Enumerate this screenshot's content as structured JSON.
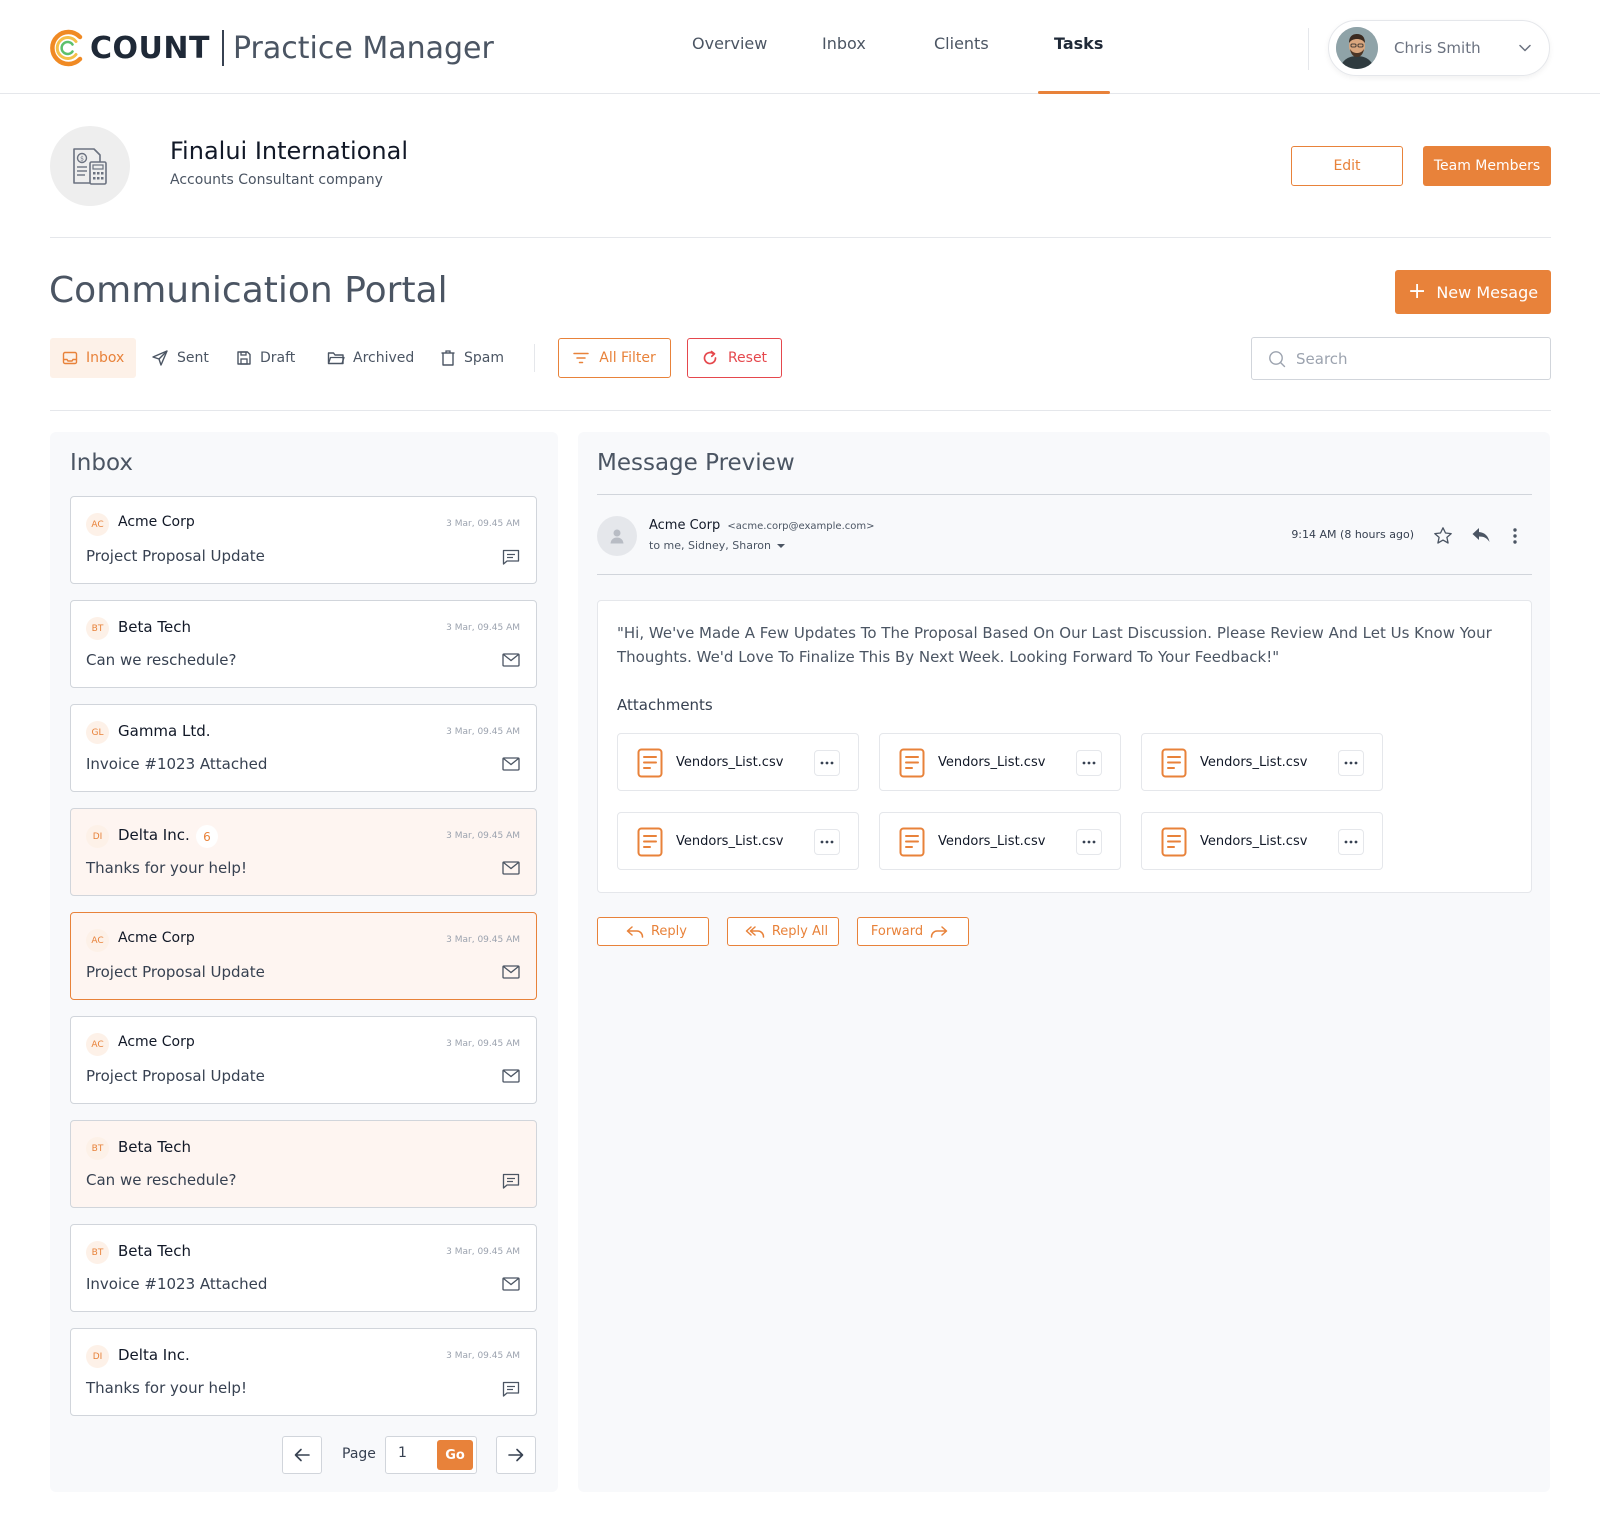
{
  "app": {
    "brand": "COUNT",
    "product": "Practice Manager"
  },
  "nav": {
    "items": [
      {
        "label": "Overview",
        "active": false
      },
      {
        "label": "Inbox",
        "active": false
      },
      {
        "label": "Clients",
        "active": false
      },
      {
        "label": "Tasks",
        "active": true
      }
    ]
  },
  "user": {
    "name": "Chris Smith"
  },
  "client": {
    "name": "Finalui International",
    "subtitle": "Accounts Consultant company",
    "edit_label": "Edit",
    "team_label": "Team Members"
  },
  "portal": {
    "title": "Communication Portal",
    "new_message_label": "New Mesage",
    "tabs": [
      {
        "label": "Inbox",
        "icon": "inbox-icon",
        "active": true
      },
      {
        "label": "Sent",
        "icon": "send-icon",
        "active": false
      },
      {
        "label": "Draft",
        "icon": "save-icon",
        "active": false
      },
      {
        "label": "Archived",
        "icon": "folder-icon",
        "active": false
      },
      {
        "label": "Spam",
        "icon": "trash-icon",
        "active": false
      }
    ],
    "filter_label": "All Filter",
    "reset_label": "Reset",
    "search_placeholder": "Search"
  },
  "inbox": {
    "title": "Inbox",
    "messages": [
      {
        "initials": "AC",
        "sender": "Acme Corp",
        "time": "3 Mar, 09.45 AM",
        "subject": "Project Proposal Update",
        "icon": "message-icon",
        "state": "read"
      },
      {
        "initials": "BT",
        "sender": "Beta Tech",
        "time": "3 Mar, 09.45 AM",
        "subject": "Can we reschedule?",
        "icon": "mail-icon",
        "state": "read"
      },
      {
        "initials": "GL",
        "sender": "Gamma Ltd.",
        "time": "3 Mar, 09.45 AM",
        "subject": "Invoice #1023 Attached",
        "icon": "mail-icon",
        "state": "read"
      },
      {
        "initials": "DI",
        "sender": "Delta Inc.",
        "badge": "6",
        "time": "3 Mar, 09.45 AM",
        "subject": "Thanks for your help!",
        "icon": "mail-icon",
        "state": "unread"
      },
      {
        "initials": "AC",
        "sender": "Acme Corp",
        "time": "3 Mar, 09.45 AM",
        "subject": "Project Proposal Update",
        "icon": "mail-icon",
        "state": "selected"
      },
      {
        "initials": "AC",
        "sender": "Acme Corp",
        "time": "3 Mar, 09.45 AM",
        "subject": "Project Proposal Update",
        "icon": "mail-icon",
        "state": "read"
      },
      {
        "initials": "BT",
        "sender": "Beta Tech",
        "time": "",
        "subject": "Can we reschedule?",
        "icon": "message-icon",
        "state": "unread"
      },
      {
        "initials": "BT",
        "sender": "Beta Tech",
        "time": "3 Mar, 09.45 AM",
        "subject": "Invoice #1023 Attached",
        "icon": "mail-icon",
        "state": "read"
      },
      {
        "initials": "DI",
        "sender": "Delta Inc.",
        "time": "3 Mar, 09.45 AM",
        "subject": "Thanks for your help!",
        "icon": "message-icon",
        "state": "read"
      }
    ],
    "pagination": {
      "page_label": "Page",
      "page_value": "1",
      "go_label": "Go"
    }
  },
  "preview": {
    "title": "Message Preview",
    "from_name": "Acme Corp",
    "from_email": "<acme.corp@example.com>",
    "to": "to me, Sidney, Sharon",
    "time": "9:14 AM",
    "time_ago": "(8 hours ago)",
    "body": "\"Hi, We've Made A Few Updates To The Proposal Based On Our Last Discussion. Please Review And Let Us Know Your Thoughts. We'd Love To Finalize This By Next Week. Looking Forward To Your Feedback!\"",
    "attachments_title": "Attachments",
    "attachments": [
      {
        "name": "Vendors_List.csv"
      },
      {
        "name": "Vendors_List.csv"
      },
      {
        "name": "Vendors_List.csv"
      },
      {
        "name": "Vendors_List.csv"
      },
      {
        "name": "Vendors_List.csv"
      },
      {
        "name": "Vendors_List.csv"
      }
    ],
    "reply_label": "Reply",
    "reply_all_label": "Reply  All",
    "forward_label": "Forward"
  },
  "colors": {
    "accent": "#e8823a",
    "danger": "#e5484d",
    "panel_bg": "#f8f9fb"
  }
}
